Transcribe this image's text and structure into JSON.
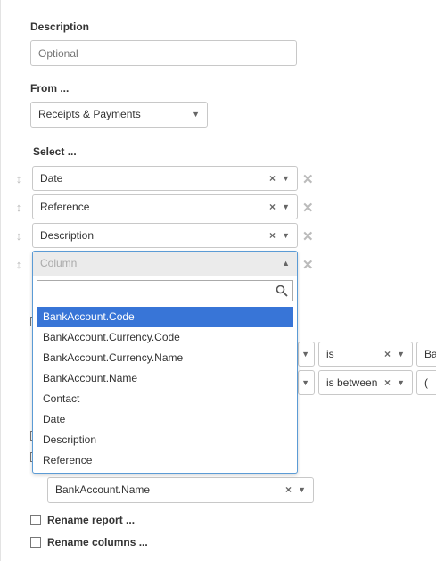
{
  "description": {
    "label": "Description",
    "placeholder": "Optional"
  },
  "from": {
    "label": "From ...",
    "value": "Receipts & Payments"
  },
  "select": {
    "label": "Select ...",
    "columns": [
      "Date",
      "Reference",
      "Description"
    ],
    "new_column_placeholder": "Column"
  },
  "column_dropdown": {
    "options": [
      "BankAccount.Code",
      "BankAccount.Currency.Code",
      "BankAccount.Currency.Name",
      "BankAccount.Name",
      "Contact",
      "Date",
      "Description",
      "Reference"
    ],
    "active_index": 0
  },
  "conditions": [
    {
      "operator": "is",
      "value_partial": "Ba"
    },
    {
      "operator": "is between",
      "value_partial": "("
    }
  ],
  "group_by": {
    "value": "BankAccount.Name"
  },
  "options": {
    "rename_report": "Rename report ...",
    "rename_columns": "Rename columns ..."
  },
  "icons": {
    "clear": "×",
    "caret_down": "▼",
    "caret_up": "▲",
    "handle": "↕",
    "remove": "✕"
  }
}
